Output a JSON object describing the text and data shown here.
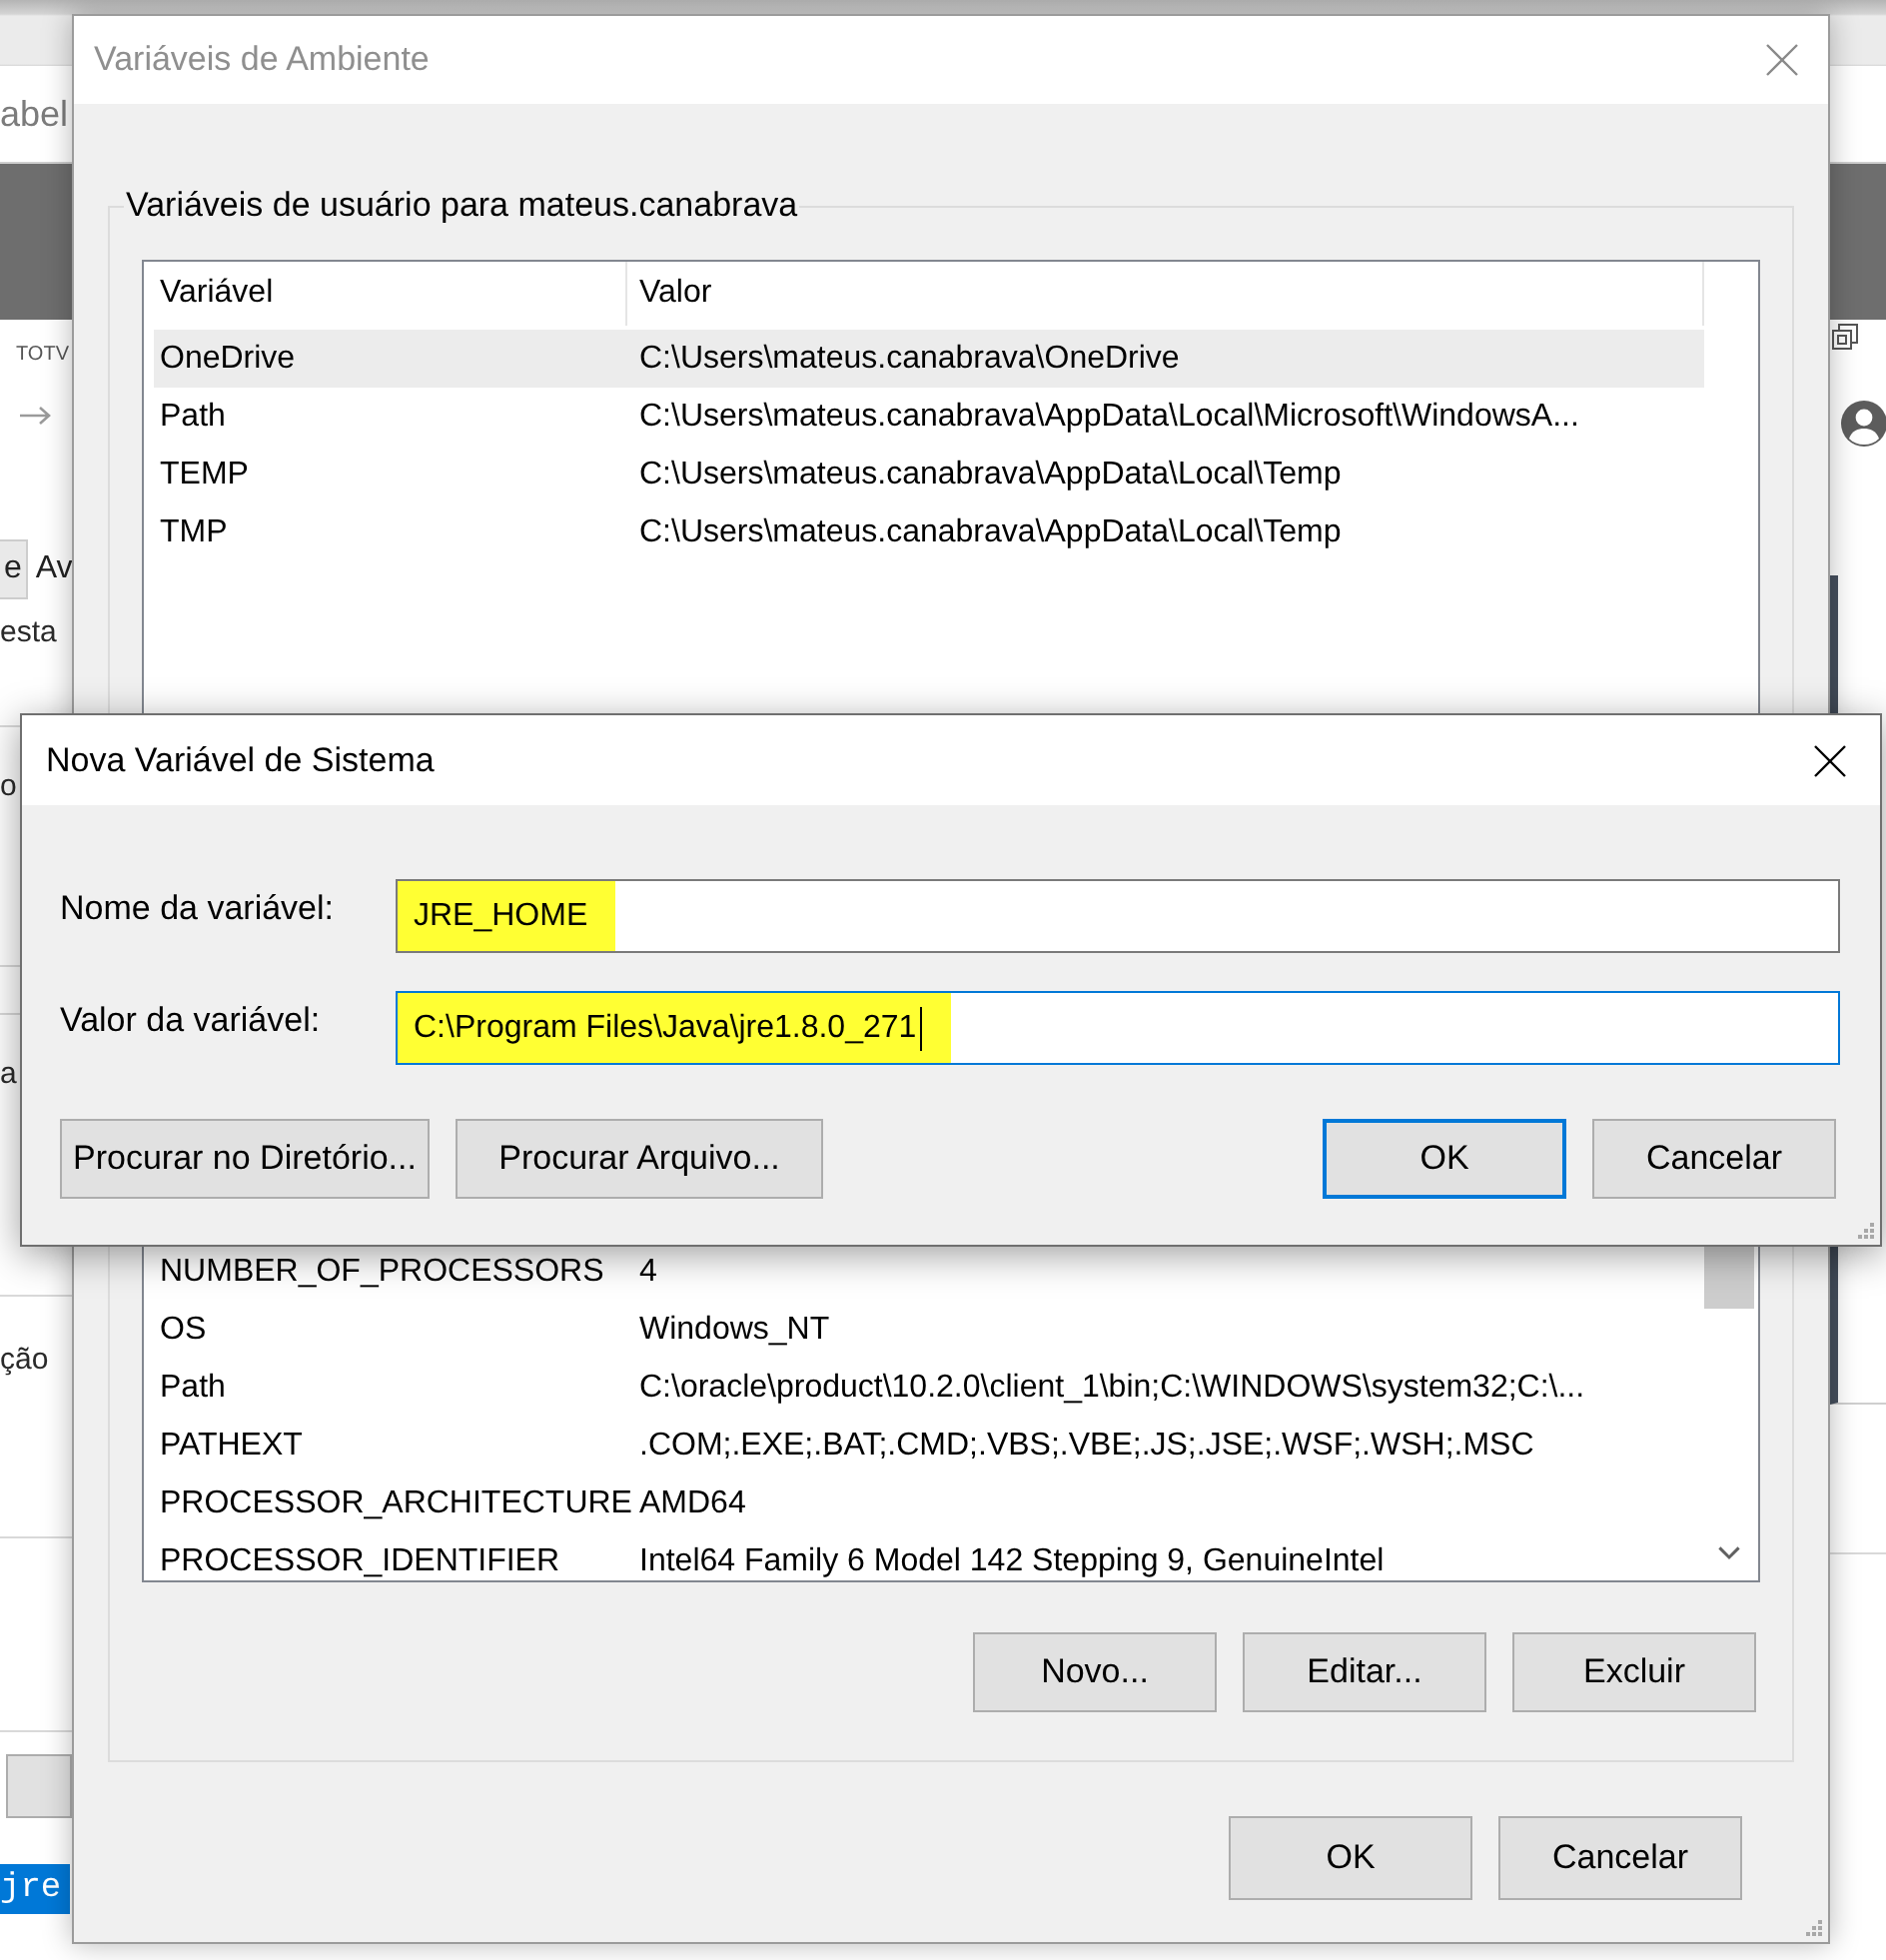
{
  "background": {
    "address_text": "abel",
    "toolbar_text": "TOTV",
    "tabs": [
      {
        "label": "e",
        "selected": false
      },
      {
        "label": "Av",
        "selected": true
      }
    ],
    "texts": [
      "esta",
      "o",
      "a",
      "ção"
    ],
    "selection": {
      "text": "jre",
      "selected": true
    }
  },
  "env_dialog": {
    "title": "Variáveis de Ambiente",
    "active": false,
    "user_variables": {
      "title": "Variáveis de usuário para mateus.canabrava",
      "columns": [
        "Variável",
        "Valor"
      ],
      "rows": [
        {
          "name": "OneDrive",
          "value": "C:\\Users\\mateus.canabrava\\OneDrive",
          "selected": true
        },
        {
          "name": "Path",
          "value": "C:\\Users\\mateus.canabrava\\AppData\\Local\\Microsoft\\WindowsA...",
          "selected": false
        },
        {
          "name": "TEMP",
          "value": "C:\\Users\\mateus.canabrava\\AppData\\Local\\Temp",
          "selected": false
        },
        {
          "name": "TMP",
          "value": "C:\\Users\\mateus.canabrava\\AppData\\Local\\Temp",
          "selected": false
        }
      ]
    },
    "system_variables": {
      "rows": [
        {
          "name": "NUMBER_OF_PROCESSORS",
          "value": "4",
          "selected": false
        },
        {
          "name": "OS",
          "value": "Windows_NT",
          "selected": false
        },
        {
          "name": "Path",
          "value": "C:\\oracle\\product\\10.2.0\\client_1\\bin;C:\\WINDOWS\\system32;C:\\...",
          "selected": false
        },
        {
          "name": "PATHEXT",
          "value": ".COM;.EXE;.BAT;.CMD;.VBS;.VBE;.JS;.JSE;.WSF;.WSH;.MSC",
          "selected": false
        },
        {
          "name": "PROCESSOR_ARCHITECTURE",
          "value": "AMD64",
          "selected": false
        },
        {
          "name": "PROCESSOR_IDENTIFIER",
          "value": "Intel64 Family 6 Model 142 Stepping 9, GenuineIntel",
          "selected": false
        }
      ],
      "buttons": [
        "Novo...",
        "Editar...",
        "Excluir"
      ]
    },
    "buttons": [
      "OK",
      "Cancelar"
    ]
  },
  "new_variable_dialog": {
    "title": "Nova Variável de Sistema",
    "active": true,
    "fields": [
      {
        "label": "Nome da variável:",
        "value": "JRE_HOME",
        "focused": false,
        "highlighted": true
      },
      {
        "label": "Valor da variável:",
        "value": "C:\\Program Files\\Java\\jre1.8.0_271",
        "focused": true,
        "highlighted": true
      }
    ],
    "browse_buttons": [
      "Procurar no Diretório...",
      "Procurar Arquivo..."
    ],
    "buttons": [
      {
        "label": "OK",
        "default": true
      },
      {
        "label": "Cancelar",
        "default": false
      }
    ]
  }
}
